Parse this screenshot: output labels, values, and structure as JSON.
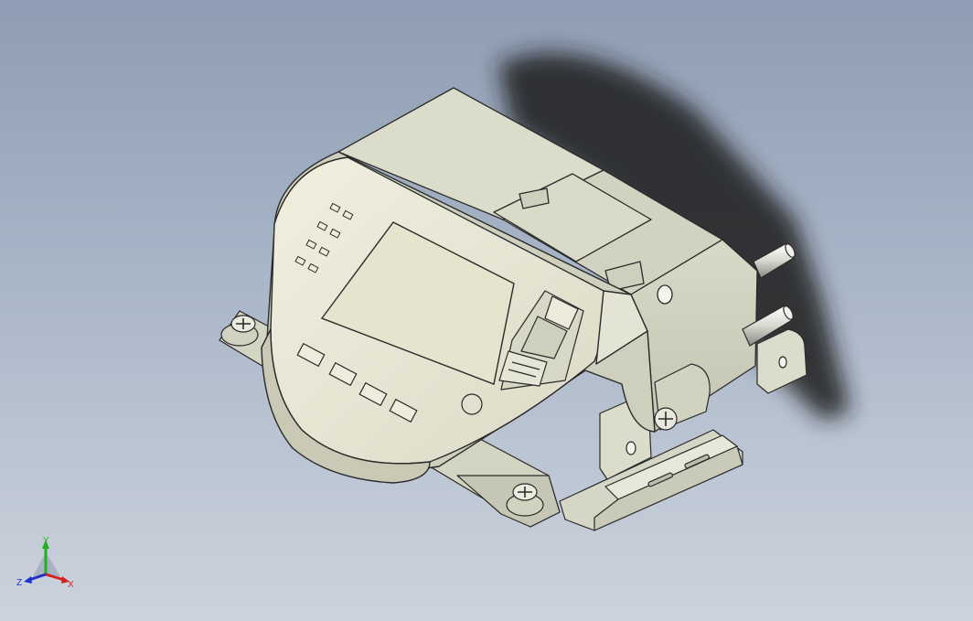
{
  "viewport": {
    "background_top": "#8e9db3",
    "background_bottom": "#cdd3dd",
    "model_name": "device-with-display-on-din-rail"
  },
  "model": {
    "body_color": "#dedfcf",
    "face_color": "#e9e8d6",
    "outline_color": "#2a2a2a",
    "screen_color": "#e6e4cf",
    "shadow_color": "#1c1c1c"
  },
  "axis_triad": {
    "x_label": "X",
    "y_label": "Y",
    "z_label": "Z",
    "x_color": "#d42020",
    "y_color": "#22b022",
    "z_color": "#2030d0"
  }
}
